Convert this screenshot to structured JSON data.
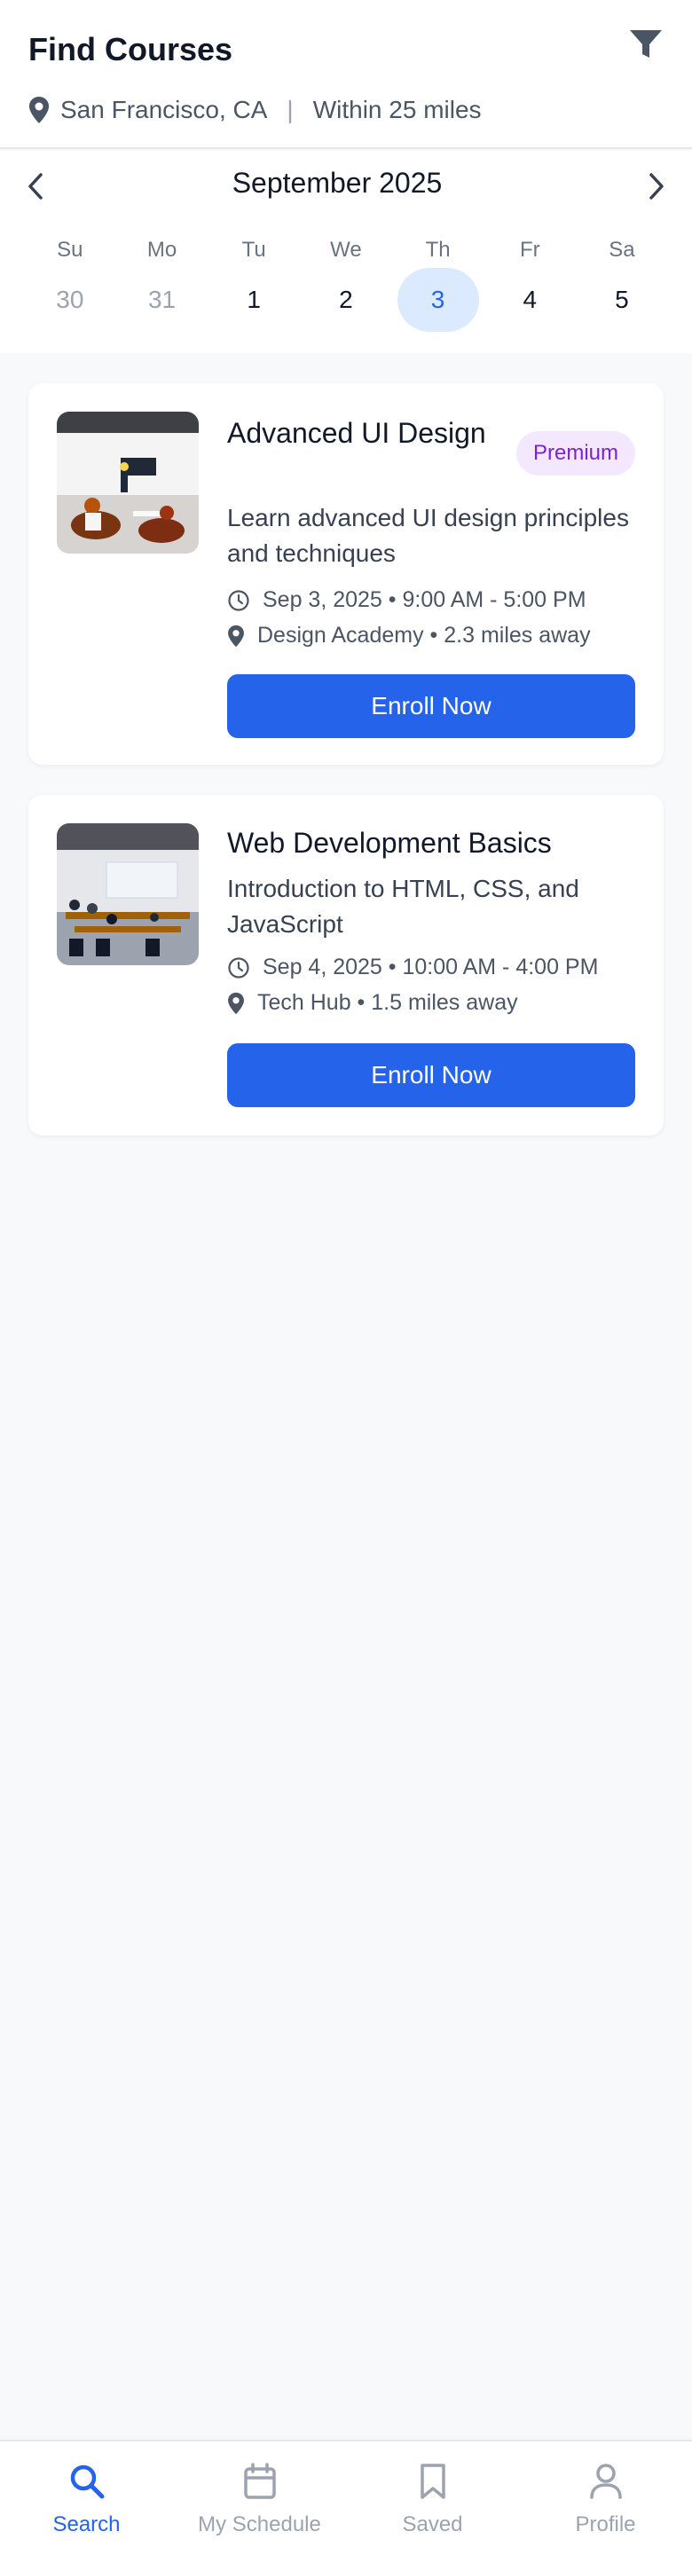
{
  "header": {
    "title": "Find Courses",
    "location": "San Francisco, CA",
    "separator": "|",
    "radius": "Within 25 miles",
    "icons": {
      "location": "map-pin-icon",
      "filter": "filter-icon"
    }
  },
  "calendar": {
    "month": "September 2025",
    "weekdays": [
      "Su",
      "Mo",
      "Tu",
      "We",
      "Th",
      "Fr",
      "Sa"
    ],
    "days": [
      "30",
      "31",
      "1",
      "2",
      "3",
      "4",
      "5"
    ],
    "selected_day": "3",
    "icons": {
      "prev": "chevron-left-icon",
      "next": "chevron-right-icon"
    }
  },
  "courses": [
    {
      "title": "Advanced UI Design",
      "badge": "Premium",
      "description": "Learn advanced UI design principles and techniques",
      "datetime": "Sep 3, 2025 • 9:00 AM - 5:00 PM",
      "location": "Design Academy • 2.3 miles away",
      "cta": "Enroll Now"
    },
    {
      "title": "Web Development Basics",
      "description": "Introduction to HTML, CSS, and JavaScript",
      "datetime": "Sep 4, 2025 • 10:00 AM - 4:00 PM",
      "location": "Tech Hub • 1.5 miles away",
      "cta": "Enroll Now"
    }
  ],
  "tabs": [
    {
      "label": "Search",
      "icon": "search-icon",
      "active": true
    },
    {
      "label": "My Schedule",
      "icon": "calendar-icon",
      "active": false
    },
    {
      "label": "Saved",
      "icon": "bookmark-icon",
      "active": false
    },
    {
      "label": "Profile",
      "icon": "user-icon",
      "active": false
    }
  ],
  "colors": {
    "accent": "#2563eb",
    "selected_day_bg": "#dbeafe",
    "badge_bg": "#f3e8ff",
    "badge_text": "#7e22ce",
    "page_bg": "#f8f9fb"
  }
}
